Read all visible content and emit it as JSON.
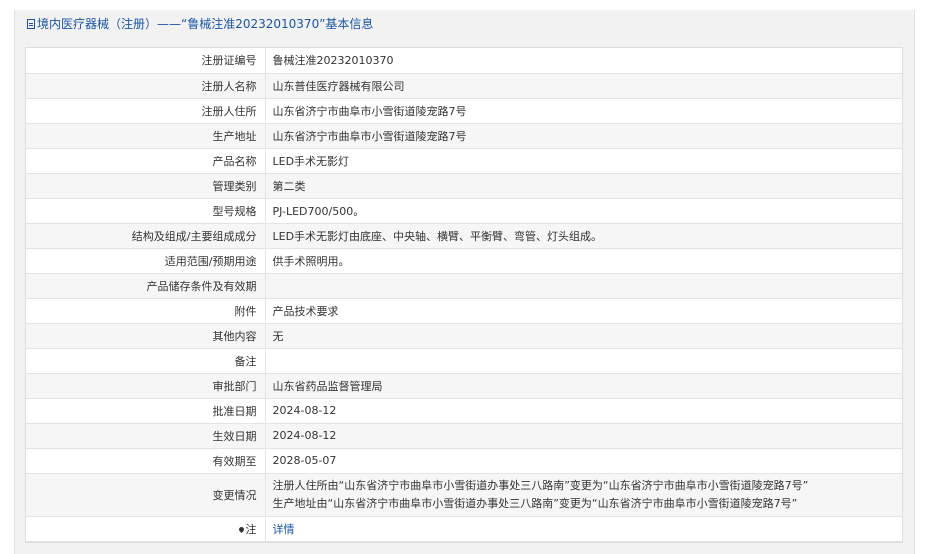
{
  "header": {
    "title": "境内医疗器械（注册）——“鲁械注准20232010370”基本信息"
  },
  "rows": [
    {
      "label": "注册证编号",
      "value": "鲁械注准20232010370"
    },
    {
      "label": "注册人名称",
      "value": "山东普佳医疗器械有限公司"
    },
    {
      "label": "注册人住所",
      "value": "山东省济宁市曲阜市小雪街道陵宠路7号"
    },
    {
      "label": "生产地址",
      "value": "山东省济宁市曲阜市小雪街道陵宠路7号"
    },
    {
      "label": "产品名称",
      "value": "LED手术无影灯"
    },
    {
      "label": "管理类别",
      "value": "第二类"
    },
    {
      "label": "型号规格",
      "value": "PJ-LED700/500。"
    },
    {
      "label": "结构及组成/主要组成成分",
      "value": "LED手术无影灯由底座、中央轴、横臂、平衡臂、弯管、灯头组成。"
    },
    {
      "label": "适用范围/预期用途",
      "value": "供手术照明用。"
    },
    {
      "label": "产品储存条件及有效期",
      "value": ""
    },
    {
      "label": "附件",
      "value": "产品技术要求"
    },
    {
      "label": "其他内容",
      "value": "无"
    },
    {
      "label": "备注",
      "value": ""
    },
    {
      "label": "审批部门",
      "value": "山东省药品监督管理局"
    },
    {
      "label": "批准日期",
      "value": "2024-08-12"
    },
    {
      "label": "生效日期",
      "value": "2024-08-12"
    },
    {
      "label": "有效期至",
      "value": "2028-05-07"
    }
  ],
  "change": {
    "label": "变更情况",
    "line1": "注册人住所由“山东省济宁市曲阜市小雪街道办事处三八路南”变更为“山东省济宁市曲阜市小雪街道陵宠路7号”",
    "line2": "生产地址由“山东省济宁市曲阜市小雪街道办事处三八路南”变更为“山东省济宁市曲阜市小雪街道陵宠路7号”"
  },
  "note": {
    "label": "注",
    "link_text": "详情",
    "icon": "pin-icon"
  },
  "colors": {
    "accent": "#1a55a5",
    "row_shade": "#f6f6f6",
    "panel_bg": "#f2f2f2"
  }
}
